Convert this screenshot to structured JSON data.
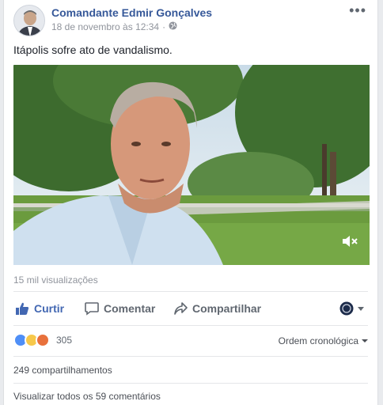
{
  "post": {
    "author": "Comandante Edmir Gonçalves",
    "timestamp": "18 de novembro às 12:34",
    "separator": "·",
    "privacy_icon": "globe-icon",
    "more_label": "•••",
    "text": "Itápolis sofre ato de vandalismo."
  },
  "video": {
    "views": "15 mil visualizações",
    "mute_icon": "speaker-muted-icon"
  },
  "actions": {
    "like": "Curtir",
    "comment": "Comentar",
    "share": "Compartilhar"
  },
  "reactions": {
    "types": [
      "like",
      "sad",
      "angry"
    ],
    "count": "305",
    "ordering": "Ordem cronológica"
  },
  "shares": "249 compartilhamentos",
  "comments_link": "Visualizar todos os 59 comentários",
  "colors": {
    "link_blue": "#365899",
    "like_blue": "#4267b2",
    "meta_gray": "#90949c"
  }
}
